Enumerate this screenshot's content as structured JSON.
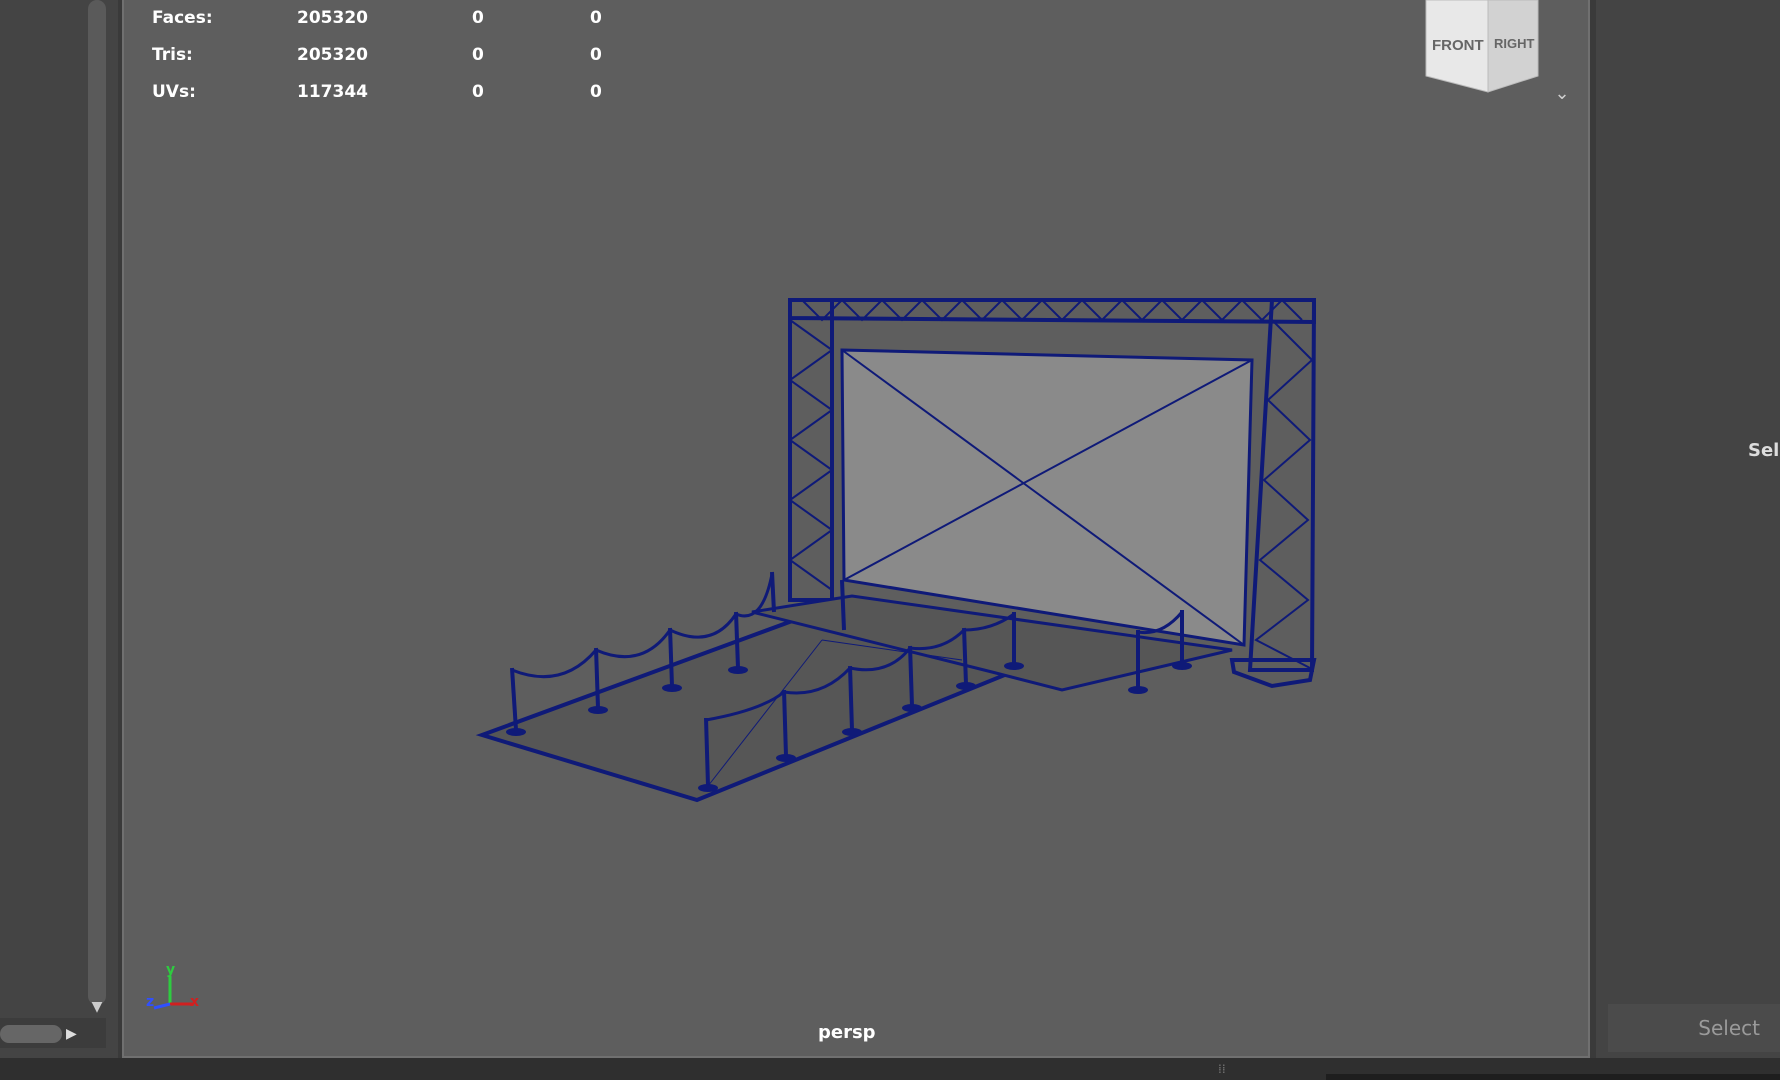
{
  "hud": {
    "rows": [
      {
        "label": "Faces:",
        "v1": "205320",
        "v2": "0",
        "v3": "0"
      },
      {
        "label": "Tris:",
        "v1": "205320",
        "v2": "0",
        "v3": "0"
      },
      {
        "label": "UVs:",
        "v1": "117344",
        "v2": "0",
        "v3": "0"
      }
    ]
  },
  "viewcube": {
    "front": "FRONT",
    "right": "RIGHT"
  },
  "axis": {
    "y": "y",
    "z": "z",
    "x": "x"
  },
  "viewport": {
    "camera_label": "persp"
  },
  "right_panel": {
    "partial_text": "Sele",
    "select_button": "Select"
  },
  "colors": {
    "wireframe": "#0f1a78",
    "viewport_bg": "#5e5e5e",
    "screen_fill": "#8a8a8a"
  },
  "icons": [
    "chevron-down-icon",
    "arrow-down-icon",
    "arrow-right-icon",
    "axis-gizmo-icon",
    "view-cube-icon"
  ]
}
